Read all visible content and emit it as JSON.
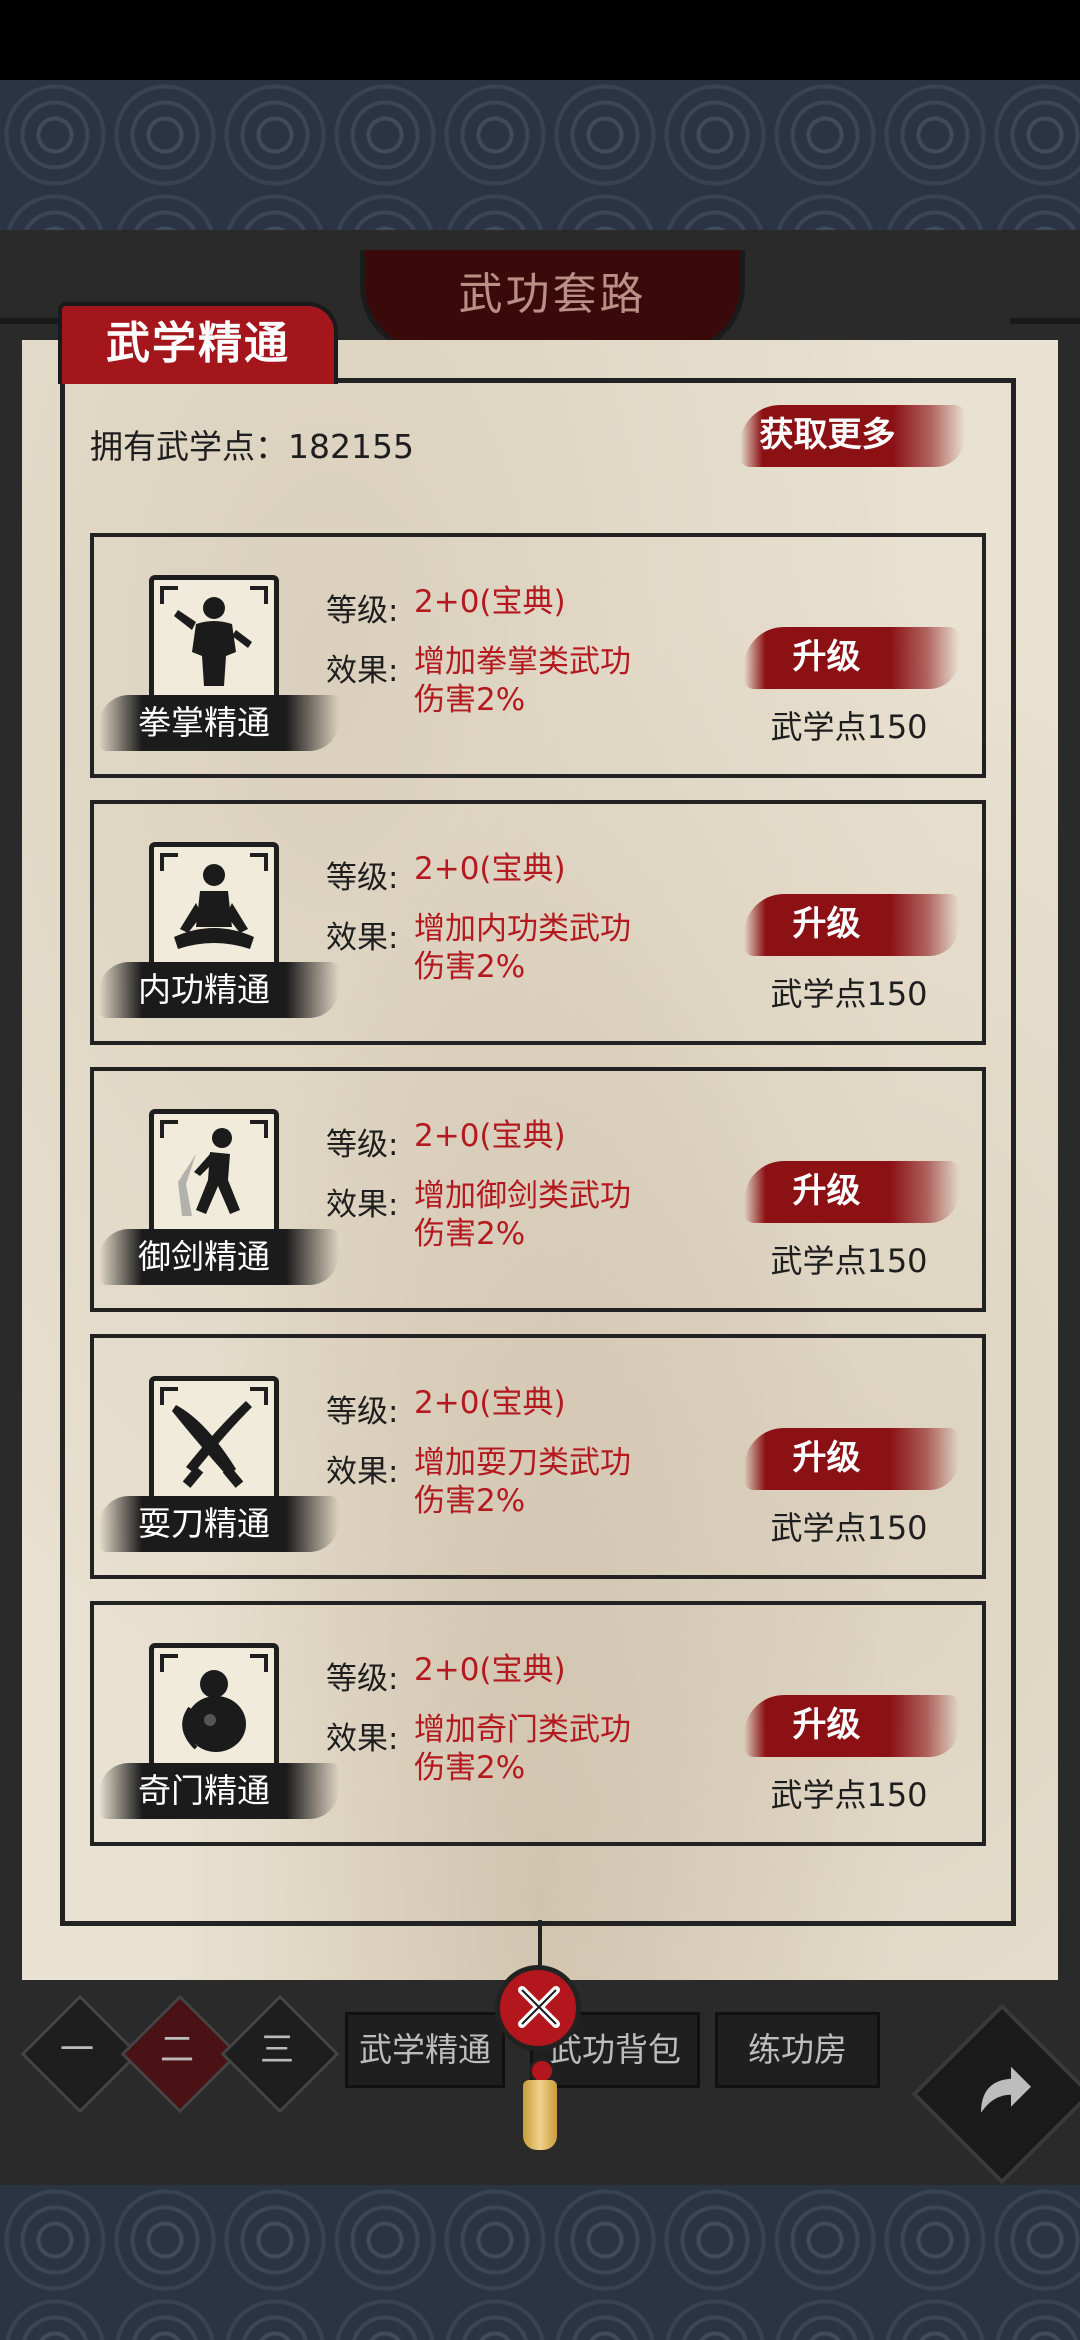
{
  "header": {
    "tab_title": "武功套路"
  },
  "panel": {
    "title": "武学精通",
    "points_label": "拥有武学点：",
    "points_value": "182155",
    "get_more_label": "获取更多"
  },
  "labels": {
    "level": "等级:",
    "effect": "效果:"
  },
  "skills": [
    {
      "name": "拳掌精通",
      "icon": "fist-palm-figure-icon",
      "level": "2+0(宝典)",
      "effect_line1": "增加拳掌类武功",
      "effect_line2": "伤害2%",
      "upgrade_label": "升级",
      "cost": "武学点150"
    },
    {
      "name": "内功精通",
      "icon": "meditation-figure-icon",
      "level": "2+0(宝典)",
      "effect_line1": "增加内功类武功",
      "effect_line2": "伤害2%",
      "upgrade_label": "升级",
      "cost": "武学点150"
    },
    {
      "name": "御剑精通",
      "icon": "running-figure-icon",
      "level": "2+0(宝典)",
      "effect_line1": "增加御剑类武功",
      "effect_line2": "伤害2%",
      "upgrade_label": "升级",
      "cost": "武学点150"
    },
    {
      "name": "耍刀精通",
      "icon": "crossed-blades-icon",
      "level": "2+0(宝典)",
      "effect_line1": "增加耍刀类武功",
      "effect_line2": "伤害2%",
      "upgrade_label": "升级",
      "cost": "武学点150"
    },
    {
      "name": "奇门精通",
      "icon": "gourd-weapon-icon",
      "level": "2+0(宝典)",
      "effect_line1": "增加奇门类武功",
      "effect_line2": "伤害2%",
      "upgrade_label": "升级",
      "cost": "武学点150"
    }
  ],
  "bottom_nav": {
    "pages": [
      "一",
      "二",
      "三"
    ],
    "active_page": "二",
    "tabs": [
      "武学精通",
      "武功背包",
      "练功房"
    ]
  },
  "colors": {
    "accent_red": "#b3191f",
    "paper": "#e9e1d1",
    "ink": "#1e1e1e"
  }
}
